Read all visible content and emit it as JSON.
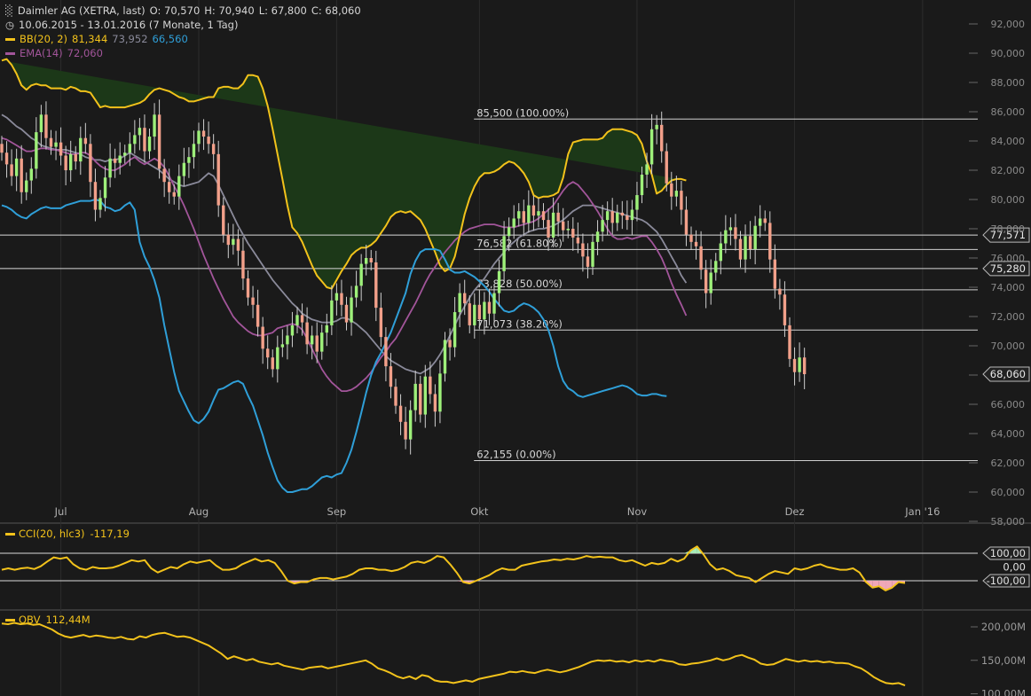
{
  "header": {
    "instrument": "Daimler AG (XETRA, last)",
    "ohlc": {
      "open": "O: 70,570",
      "high": "H: 70,940",
      "low": "L: 67,800",
      "close": "C: 68,060"
    },
    "period": "10.06.2015 - 13.01.2016 (7 Monate, 1 Tag)",
    "bb": {
      "label": "BB(20, 2)",
      "upper": "81,344",
      "mid": "73,952",
      "lower": "66,560"
    },
    "ema": {
      "label": "EMA(14)",
      "value": "72,060"
    }
  },
  "colors": {
    "background": "#1a1a1a",
    "bb_upper": "#f2c21b",
    "bb_mid": "#8a8a9a",
    "bb_lower": "#2f9fd8",
    "bb_fill": "#1c3818",
    "ema": "#a2559a",
    "candle_up": "#9ef07a",
    "candle_down": "#f2a08a",
    "cci": "#f2c21b",
    "obv": "#f2c21b",
    "cci_pos_fill": "#a8ecb8",
    "cci_neg_fill": "#f0a8b8",
    "grid": "#3a3a3a",
    "fib_line": "#cfcfcf"
  },
  "chart_data": [
    {
      "type": "candlestick",
      "title": "Daimler AG (XETRA, last)",
      "y_axis_ticks": [
        "92,000",
        "90,000",
        "88,000",
        "86,000",
        "84,000",
        "82,000",
        "80,000",
        "78,000",
        "76,000",
        "74,000",
        "72,000",
        "70,000",
        "68,000",
        "66,000",
        "64,000",
        "62,000",
        "60,000",
        "58,000"
      ],
      "ylim": [
        58,
        93
      ],
      "x_tick_labels": [
        "Jul",
        "Aug",
        "Sep",
        "Okt",
        "Nov",
        "Dez",
        "Jan '16"
      ],
      "x_tick_index": [
        12,
        40,
        68,
        97,
        129,
        161,
        187
      ],
      "last_value": {
        "label": "68,060",
        "value": 68.06
      },
      "horizontal_levels": [
        {
          "label": "77,571",
          "value": 77.571
        },
        {
          "label": "75,280",
          "value": 75.28
        }
      ],
      "fibonacci": [
        {
          "label": "85,500 (100.00%)",
          "value": 85.5
        },
        {
          "label": "76,582 (61.80%)",
          "value": 76.582
        },
        {
          "label": "73,828 (50.00%)",
          "value": 73.828
        },
        {
          "label": "71,073 (38.20%)",
          "value": 71.073
        },
        {
          "label": "62,155 (0.00%)",
          "value": 62.155
        }
      ],
      "fib_start_index": 104,
      "close": [
        83.2,
        82.4,
        81.6,
        82.8,
        80.5,
        81.3,
        82.1,
        84.6,
        85.8,
        84.2,
        83.6,
        83.9,
        83.0,
        82.0,
        83.1,
        82.6,
        84.2,
        83.8,
        81.2,
        79.3,
        80.1,
        81.5,
        82.8,
        82.5,
        83.0,
        83.2,
        83.8,
        84.4,
        84.9,
        83.3,
        84.3,
        85.8,
        82.1,
        81.2,
        80.5,
        80.2,
        81.6,
        82.5,
        82.9,
        83.8,
        84.7,
        84.3,
        83.8,
        83.1,
        79.6,
        77.6,
        76.9,
        77.3,
        76.5,
        74.6,
        73.3,
        72.8,
        71.3,
        69.8,
        69.2,
        68.4,
        69.9,
        70.1,
        70.7,
        71.4,
        72.1,
        71.6,
        70.1,
        70.7,
        69.6,
        70.9,
        71.4,
        73.1,
        73.6,
        72.8,
        71.6,
        73.3,
        74.1,
        75.6,
        76.0,
        75.7,
        72.6,
        70.6,
        68.6,
        67.2,
        65.9,
        64.8,
        63.6,
        65.6,
        67.4,
        65.3,
        67.9,
        66.7,
        65.5,
        68.1,
        70.4,
        69.9,
        72.3,
        73.6,
        72.9,
        71.4,
        72.8,
        71.8,
        73.0,
        72.2,
        73.6,
        75.1,
        77.5,
        78.1,
        78.7,
        79.2,
        78.4,
        79.6,
        78.9,
        79.2,
        78.6,
        77.4,
        79.1,
        78.5,
        77.9,
        78.0,
        77.4,
        77.0,
        76.1,
        75.4,
        77.1,
        77.8,
        78.6,
        79.2,
        78.4,
        79.1,
        78.9,
        78.6,
        79.3,
        80.3,
        81.7,
        82.4,
        84.8,
        85.1,
        83.3,
        81.1,
        80.2,
        80.6,
        79.3,
        77.6,
        77.1,
        76.8,
        75.2,
        73.6,
        75.0,
        75.8,
        77.0,
        77.9,
        78.1,
        77.3,
        75.9,
        77.5,
        76.6,
        78.2,
        78.7,
        78.4,
        75.9,
        73.9,
        73.5,
        71.4,
        69.1,
        68.2,
        69.2,
        68.06
      ],
      "bb_upper": [
        89.5,
        89.6,
        89.2,
        88.6,
        87.8,
        87.5,
        87.8,
        87.9,
        87.8,
        87.8,
        87.6,
        87.6,
        87.6,
        87.5,
        87.7,
        87.6,
        87.4,
        87.4,
        87.3,
        86.8,
        86.3,
        86.4,
        86.3,
        86.3,
        86.3,
        86.3,
        86.4,
        86.5,
        86.6,
        86.8,
        87.2,
        87.5,
        87.6,
        87.5,
        87.4,
        87.2,
        87.0,
        86.9,
        86.7,
        86.7,
        86.8,
        86.9,
        87.0,
        87.0,
        87.6,
        87.7,
        87.7,
        87.6,
        87.6,
        87.9,
        88.5,
        88.5,
        88.4,
        87.6,
        86.4,
        84.8,
        83.1,
        81.4,
        79.6,
        78.1,
        77.7,
        77.1,
        76.3,
        75.5,
        74.8,
        74.4,
        74.0,
        73.9,
        74.5,
        75.1,
        75.6,
        76.2,
        76.5,
        76.7,
        76.7,
        76.9,
        77.2,
        77.7,
        78.2,
        78.8,
        79.1,
        79.2,
        79.1,
        79.2,
        78.9,
        78.6,
        78.0,
        77.2,
        76.4,
        75.5,
        75.1,
        75.3,
        76.1,
        77.5,
        79.0,
        80.1,
        80.9,
        81.5,
        81.8,
        81.8,
        81.9,
        82.1,
        82.4,
        82.6,
        82.5,
        82.2,
        81.8,
        81.2,
        80.3,
        80.1,
        80.2,
        80.2,
        80.3,
        80.5,
        81.5,
        83.1,
        83.9,
        84.0,
        84.1,
        84.1,
        84.1,
        84.1,
        84.2,
        84.6,
        84.8,
        84.8,
        84.8,
        84.7,
        84.6,
        84.4,
        83.8,
        82.6,
        81.7,
        80.4,
        80.6,
        81.0,
        81.3,
        81.4,
        81.4,
        81.3
      ],
      "bb_mid": [
        85.8,
        85.6,
        85.3,
        85.0,
        84.8,
        84.5,
        84.2,
        84.0,
        83.7,
        83.6,
        83.5,
        83.4,
        83.4,
        83.4,
        83.3,
        83.2,
        83.1,
        82.9,
        82.8,
        82.7,
        82.7,
        82.6,
        82.7,
        82.7,
        82.8,
        83.0,
        83.2,
        83.0,
        82.8,
        82.6,
        82.4,
        82.2,
        82.0,
        81.7,
        81.4,
        81.2,
        81.0,
        80.9,
        81.0,
        81.1,
        81.2,
        81.5,
        81.8,
        81.6,
        81.0,
        80.3,
        79.6,
        78.9,
        78.2,
        77.6,
        77.0,
        76.5,
        76.0,
        75.5,
        75.0,
        74.5,
        74.1,
        73.7,
        73.3,
        72.9,
        72.6,
        72.2,
        72.0,
        71.8,
        71.7,
        71.6,
        71.6,
        71.6,
        71.7,
        71.9,
        71.9,
        71.7,
        71.5,
        71.2,
        70.9,
        70.5,
        70.1,
        69.7,
        69.3,
        69.0,
        68.8,
        68.6,
        68.4,
        68.3,
        68.2,
        68.1,
        68.3,
        68.5,
        68.9,
        69.4,
        70.0,
        70.7,
        71.4,
        72.1,
        72.7,
        73.3,
        73.8,
        74.2,
        74.6,
        75.1,
        75.6,
        76.0,
        76.4,
        76.8,
        77.1,
        77.4,
        77.6,
        77.8,
        77.9,
        78.0,
        78.0,
        78.1,
        78.2,
        78.4,
        78.6,
        78.9,
        79.2,
        79.4,
        79.6,
        79.6,
        79.6,
        79.5,
        79.4,
        79.3,
        79.2,
        79.1,
        79.0,
        78.9,
        78.8,
        78.7,
        78.6,
        78.4,
        78.1,
        77.8,
        77.3,
        76.7,
        76.1,
        75.5,
        74.8,
        74.3
      ],
      "bb_lower": [
        79.6,
        79.5,
        79.3,
        79.0,
        78.8,
        78.7,
        79.0,
        79.2,
        79.4,
        79.5,
        79.4,
        79.4,
        79.4,
        79.6,
        79.7,
        79.8,
        79.9,
        79.9,
        79.9,
        80.0,
        79.9,
        79.5,
        79.4,
        79.2,
        79.3,
        79.6,
        79.8,
        79.3,
        77.1,
        76.1,
        75.4,
        74.5,
        73.3,
        71.4,
        69.8,
        68.2,
        66.9,
        66.2,
        65.5,
        64.9,
        64.7,
        65.0,
        65.5,
        66.3,
        67.0,
        67.1,
        67.3,
        67.5,
        67.6,
        67.4,
        66.6,
        65.9,
        64.9,
        63.9,
        62.7,
        61.7,
        60.8,
        60.3,
        60.0,
        60.0,
        60.1,
        60.2,
        60.2,
        60.4,
        60.7,
        61.0,
        61.1,
        61.0,
        61.2,
        61.3,
        62.0,
        62.9,
        64.1,
        65.4,
        66.8,
        68.0,
        68.9,
        69.5,
        70.2,
        70.9,
        71.8,
        72.7,
        73.6,
        74.9,
        75.8,
        76.4,
        76.6,
        76.6,
        76.6,
        76.5,
        75.9,
        75.2,
        75.0,
        75.0,
        75.1,
        74.9,
        74.7,
        74.4,
        74.1,
        73.7,
        73.2,
        72.8,
        72.4,
        72.3,
        72.4,
        72.7,
        72.9,
        72.8,
        72.6,
        72.3,
        71.8,
        71.1,
        70.0,
        68.6,
        67.6,
        67.1,
        66.9,
        66.6,
        66.5,
        66.6,
        66.7,
        66.8,
        66.9,
        67.0,
        67.1,
        67.2,
        67.3,
        67.2,
        67.0,
        66.7,
        66.6,
        66.6,
        66.7,
        66.7,
        66.6,
        66.56
      ],
      "ema": [
        84.2,
        84.1,
        83.9,
        83.7,
        83.5,
        83.3,
        83.3,
        83.4,
        83.5,
        83.5,
        83.4,
        83.4,
        83.3,
        83.2,
        83.1,
        83.1,
        83.2,
        83.2,
        83.0,
        82.6,
        82.3,
        82.1,
        82.0,
        82.0,
        82.2,
        82.4,
        82.7,
        82.9,
        82.6,
        82.4,
        82.6,
        82.8,
        82.6,
        82.2,
        81.6,
        80.9,
        80.3,
        79.6,
        78.8,
        78.0,
        77.1,
        76.2,
        75.4,
        74.6,
        73.9,
        73.2,
        72.6,
        72.0,
        71.6,
        71.3,
        71.0,
        70.8,
        70.7,
        70.7,
        70.8,
        70.9,
        71.2,
        71.3,
        71.4,
        71.5,
        71.4,
        71.1,
        70.5,
        69.8,
        69.1,
        68.4,
        67.9,
        67.5,
        67.2,
        66.9,
        66.9,
        67.0,
        67.2,
        67.5,
        67.8,
        68.2,
        68.7,
        69.2,
        69.6,
        70.1,
        70.5,
        71.1,
        71.7,
        72.3,
        72.9,
        73.6,
        74.3,
        74.9,
        75.4,
        75.9,
        76.4,
        76.8,
        77.2,
        77.5,
        77.8,
        78.0,
        78.1,
        78.2,
        78.3,
        78.3,
        78.3,
        78.2,
        78.1,
        78.1,
        78.1,
        78.2,
        78.3,
        78.4,
        78.5,
        78.7,
        79.0,
        79.3,
        79.6,
        80.1,
        80.6,
        81.0,
        81.2,
        81.0,
        80.6,
        80.2,
        79.7,
        79.2,
        78.6,
        78.0,
        77.5,
        77.3,
        77.3,
        77.4,
        77.3,
        77.4,
        77.5,
        77.5,
        77.1,
        76.6,
        76.0,
        75.2,
        74.3,
        73.5,
        72.8,
        72.06
      ]
    },
    {
      "type": "line",
      "title": "CCI(20, hlc3)",
      "value_label": "-117,19",
      "value": -117.19,
      "y_axis_ticks": [
        "100,00",
        "0,00",
        "-100,00"
      ],
      "ylim": [
        -200,
        200
      ],
      "values": [
        -20,
        -10,
        -20,
        -10,
        -5,
        -15,
        5,
        40,
        70,
        60,
        70,
        20,
        -10,
        -20,
        0,
        -10,
        -10,
        -5,
        10,
        30,
        50,
        40,
        50,
        -10,
        -40,
        -20,
        0,
        -10,
        20,
        40,
        30,
        40,
        50,
        10,
        -20,
        -20,
        -10,
        20,
        40,
        60,
        40,
        50,
        30,
        -30,
        -100,
        -120,
        -110,
        -110,
        -90,
        -80,
        -80,
        -90,
        -80,
        -70,
        -50,
        -20,
        -10,
        -10,
        -20,
        -20,
        -30,
        -20,
        0,
        30,
        40,
        30,
        50,
        80,
        70,
        20,
        -40,
        -110,
        -120,
        -100,
        -80,
        -60,
        -30,
        -10,
        -20,
        -20,
        10,
        20,
        30,
        40,
        45,
        55,
        50,
        60,
        55,
        65,
        80,
        70,
        75,
        70,
        70,
        50,
        40,
        50,
        30,
        10,
        30,
        20,
        30,
        60,
        40,
        60,
        120,
        150,
        90,
        20,
        -20,
        -10,
        -30,
        -60,
        -70,
        -80,
        -110,
        -80,
        -50,
        -30,
        -40,
        -50,
        -10,
        -20,
        -10,
        10,
        20,
        0,
        -10,
        -20,
        -20,
        -10,
        -40,
        -110,
        -150,
        -140,
        -170,
        -150,
        -110,
        -117.19
      ]
    },
    {
      "type": "line",
      "title": "OBV",
      "value_label": "112,44M",
      "value": 112.44,
      "y_axis_ticks": [
        "200,00M",
        "150,00M",
        "100,00M"
      ],
      "ylim": [
        98,
        218
      ],
      "values": [
        205,
        204,
        206,
        204,
        205,
        203,
        204,
        200,
        196,
        190,
        186,
        184,
        186,
        188,
        185,
        187,
        186,
        184,
        183,
        185,
        182,
        181,
        186,
        184,
        188,
        190,
        191,
        188,
        185,
        186,
        184,
        180,
        176,
        172,
        166,
        160,
        152,
        156,
        153,
        150,
        152,
        148,
        146,
        144,
        146,
        142,
        140,
        138,
        136,
        139,
        140,
        141,
        138,
        140,
        142,
        144,
        146,
        148,
        150,
        145,
        138,
        135,
        131,
        126,
        123,
        126,
        122,
        128,
        126,
        120,
        118,
        118,
        116,
        118,
        120,
        118,
        122,
        124,
        126,
        128,
        130,
        133,
        132,
        134,
        132,
        131,
        134,
        136,
        134,
        132,
        134,
        137,
        140,
        144,
        148,
        150,
        149,
        150,
        148,
        149,
        147,
        150,
        148,
        150,
        148,
        151,
        149,
        148,
        144,
        143,
        145,
        146,
        148,
        150,
        153,
        150,
        152,
        156,
        158,
        154,
        151,
        145,
        143,
        144,
        148,
        152,
        150,
        148,
        150,
        148,
        149,
        147,
        148,
        146,
        146,
        145,
        141,
        138,
        132,
        125,
        120,
        116,
        115,
        116,
        112.44
      ]
    }
  ]
}
